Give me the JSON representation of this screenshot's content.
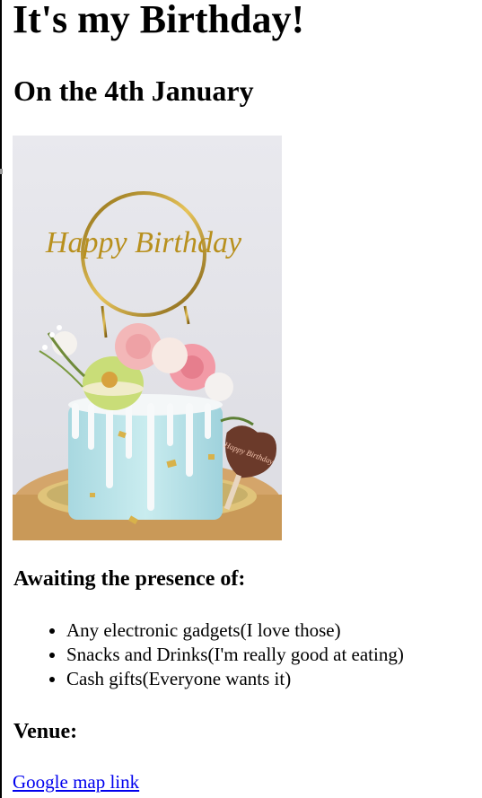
{
  "page": {
    "title": "It's my Birthday!",
    "subtitle": "On the 4th January"
  },
  "photo": {
    "icon": "birthday-cake-photo",
    "topper_text": "Happy Birthday",
    "tag_text": "Happy Birthday"
  },
  "awaiting": {
    "heading": "Awaiting the presence of:",
    "items": [
      "Any electronic gadgets(I love those)",
      "Snacks and Drinks(I'm really good at eating)",
      "Cash gifts(Everyone wants it)"
    ]
  },
  "venue": {
    "heading": "Venue:",
    "link_text": "Google map link"
  },
  "colors": {
    "link": "#0000ee",
    "text": "#000000",
    "background": "#ffffff"
  }
}
